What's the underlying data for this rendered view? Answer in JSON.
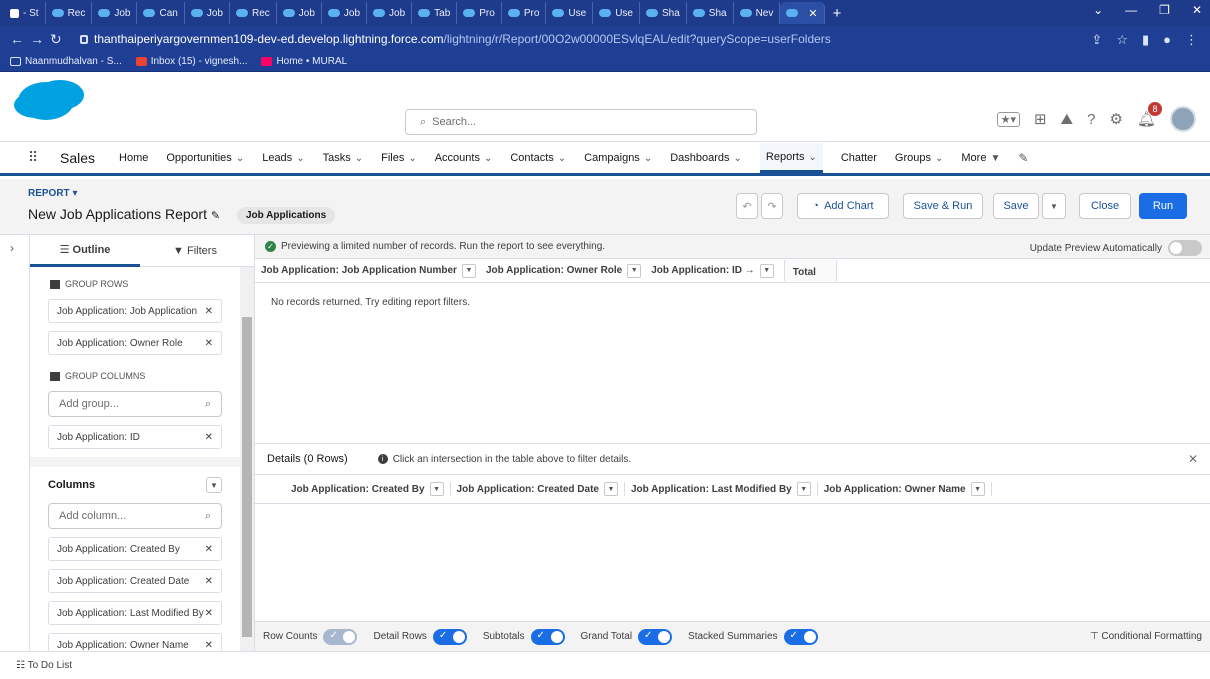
{
  "browser": {
    "tabs": [
      "- St",
      "Rec",
      "Job",
      "Can",
      "Job",
      "Rec",
      "Job",
      "Job",
      "Job",
      "Tab",
      "Pro",
      "Pro",
      "Use",
      "Use",
      "Sha",
      "Sha",
      "Nev"
    ],
    "url_host": "thanthaiperiyargovernmen109-dev-ed.develop.lightning.force.com",
    "url_path": "/lightning/r/Report/00O2w00000ESvlqEAL/edit?queryScope=userFolders",
    "bookmarks": [
      "Naanmudhalvan - S...",
      "Inbox (15) - vignesh...",
      "Home • MURAL"
    ]
  },
  "header": {
    "search_placeholder": "Search...",
    "notification_count": "8"
  },
  "nav": {
    "app_name": "Sales",
    "items": [
      "Home",
      "Opportunities",
      "Leads",
      "Tasks",
      "Files",
      "Accounts",
      "Contacts",
      "Campaigns",
      "Dashboards",
      "Reports",
      "Chatter",
      "Groups",
      "More"
    ]
  },
  "report": {
    "label": "REPORT",
    "title": "New Job Applications Report",
    "type": "Job Applications",
    "buttons": {
      "add_chart": "Add Chart",
      "save_run": "Save & Run",
      "save": "Save",
      "close": "Close",
      "run": "Run"
    }
  },
  "left_panel": {
    "tabs": [
      "Outline",
      "Filters"
    ],
    "group_rows_label": "GROUP ROWS",
    "group_rows": [
      "Job Application: Job Application",
      "Job Application: Owner Role"
    ],
    "group_columns_label": "GROUP COLUMNS",
    "add_group_placeholder": "Add group...",
    "group_columns": [
      "Job Application: ID"
    ],
    "columns_label": "Columns",
    "add_column_placeholder": "Add column...",
    "columns": [
      "Job Application: Created By",
      "Job Application: Created Date",
      "Job Application: Last Modified By",
      "Job Application: Owner Name"
    ]
  },
  "preview": {
    "info": "Previewing a limited number of records. Run the report to see everything.",
    "update_label": "Update Preview Automatically",
    "grid_headers": [
      "Job Application: Job Application Number",
      "Job Application: Owner Role",
      "Job Application: ID →"
    ],
    "total_label": "Total",
    "empty_text": "No records returned. Try editing report filters.",
    "details_label": "Details (0 Rows)",
    "details_hint": "Click an intersection in the table above to filter details.",
    "detail_headers": [
      "Job Application: Created By",
      "Job Application: Created Date",
      "Job Application: Last Modified By",
      "Job Application: Owner Name"
    ]
  },
  "footer": {
    "toggles": [
      "Row Counts",
      "Detail Rows",
      "Subtotals",
      "Grand Total",
      "Stacked Summaries"
    ],
    "conditional_formatting": "Conditional Formatting"
  },
  "utility": {
    "todo_label": "To Do List"
  },
  "colors": {
    "brand_blue": "#1b6de6",
    "nav_accent": "#1b5297",
    "browser_bg": "#1e3a8a"
  }
}
